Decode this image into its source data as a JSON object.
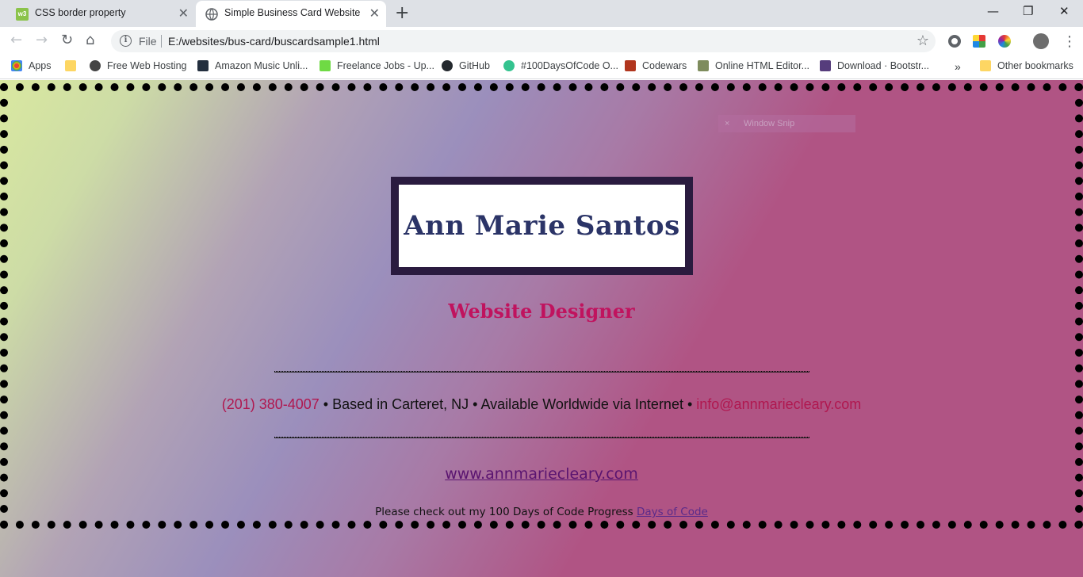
{
  "browser": {
    "tabs": [
      {
        "title": "CSS border property",
        "active": false
      },
      {
        "title": "Simple Business Card Website",
        "active": true
      }
    ],
    "new_tab_label": "+",
    "file_label": "File",
    "url": "E:/websites/bus-card/buscardsample1.html",
    "window_controls": {
      "minimize": "—",
      "restore": "❐",
      "close": "✕"
    }
  },
  "bookmarks": [
    {
      "label": "Apps",
      "icon": "apps-grid-icon"
    },
    {
      "label": "",
      "icon": "folder-icon"
    },
    {
      "label": "Free Web Hosting",
      "icon": "hosting-icon"
    },
    {
      "label": "Amazon Music Unli...",
      "icon": "amazon-icon"
    },
    {
      "label": "Freelance Jobs - Up...",
      "icon": "upwork-icon"
    },
    {
      "label": "GitHub",
      "icon": "github-icon"
    },
    {
      "label": "#100DaysOfCode O...",
      "icon": "100days-icon"
    },
    {
      "label": "Codewars",
      "icon": "codewars-icon"
    },
    {
      "label": "Online HTML Editor...",
      "icon": "html-editor-icon"
    },
    {
      "label": "Download · Bootstr...",
      "icon": "bootstrap-icon"
    },
    {
      "label": "»",
      "icon": ""
    },
    {
      "label": "Other bookmarks",
      "icon": "folder-icon"
    }
  ],
  "card": {
    "name": "Ann Marie Santos",
    "title": "Website Designer",
    "phone": "(201) 380-4007",
    "contact_middle": " • Based in Carteret, NJ • Available Worldwide via Internet • ",
    "email": "info@annmariecleary.com",
    "website": "www.annmariecleary.com",
    "progress_text": "Please check out my 100 Days of Code Progress",
    "progress_link": "Days of Code"
  },
  "overlay": {
    "snip_label": "Window Snip",
    "snip_close": "×"
  },
  "colors": {
    "accent_pink": "#c0135e",
    "name_navy": "#2b3467",
    "frame": "#2a1b3f"
  }
}
